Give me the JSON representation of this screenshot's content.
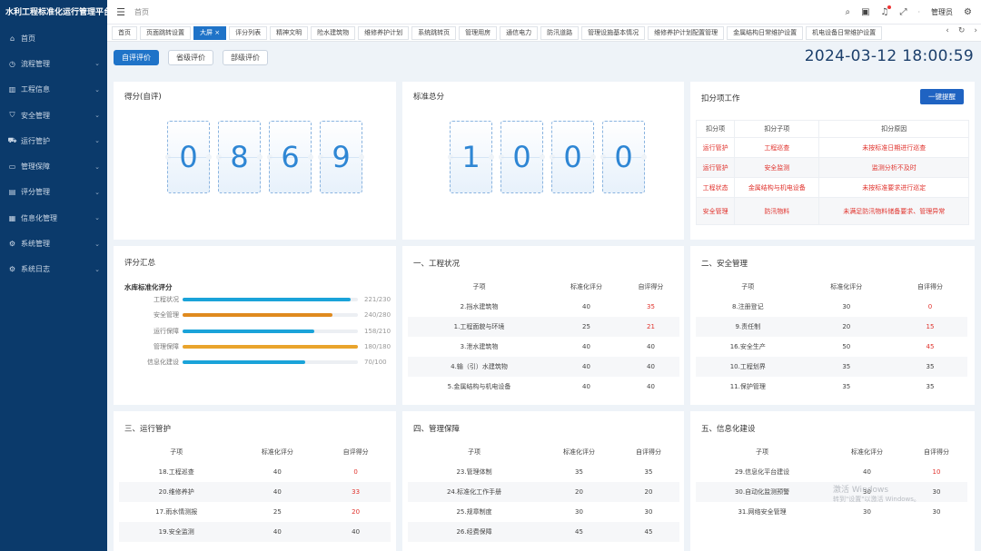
{
  "app": {
    "title": "水利工程标准化运行管理平台"
  },
  "sidebar": {
    "items": [
      {
        "label": "首页",
        "icon": "home-icon",
        "glyph": "⌂",
        "arrow": ""
      },
      {
        "label": "流程管理",
        "icon": "flow-icon",
        "glyph": "◷",
        "arrow": "⌄"
      },
      {
        "label": "工程信息",
        "icon": "building-icon",
        "glyph": "▥",
        "arrow": "⌄"
      },
      {
        "label": "安全管理",
        "icon": "shield-icon",
        "glyph": "⛉",
        "arrow": "⌄"
      },
      {
        "label": "运行管护",
        "icon": "truck-icon",
        "glyph": "⛟",
        "arrow": "⌄"
      },
      {
        "label": "管理保障",
        "icon": "monitor-icon",
        "glyph": "▭",
        "arrow": "⌄"
      },
      {
        "label": "评分管理",
        "icon": "document-icon",
        "glyph": "▤",
        "arrow": "⌄"
      },
      {
        "label": "信息化管理",
        "icon": "chart-icon",
        "glyph": "▦",
        "arrow": "⌄"
      },
      {
        "label": "系统管理",
        "icon": "gear-icon",
        "glyph": "⚙",
        "arrow": "⌄"
      },
      {
        "label": "系统日志",
        "icon": "log-icon",
        "glyph": "⚙",
        "arrow": "⌄"
      }
    ]
  },
  "topbar": {
    "breadcrumb": "首页",
    "user": "管理员"
  },
  "tabs": [
    "首页",
    "页面跳转设置",
    "大屏 ×",
    "评分列表",
    "精神文明",
    "险水建筑物",
    "维修养护计划",
    "系统跳转页",
    "管理用房",
    "通信电力",
    "防汛道路",
    "管理设施基本情况",
    "维修养护计划配置管理",
    "金属结构日常维护设置",
    "机电设备日常维护设置"
  ],
  "active_tab": 2,
  "eval_buttons": [
    "自评评价",
    "省级评价",
    "部级评价"
  ],
  "datetime": "2024-03-12 18:00:59",
  "self_score": {
    "title": "得分(自评)",
    "digits": [
      "0",
      "8",
      "6",
      "9"
    ]
  },
  "standard_total": {
    "title": "标准总分",
    "digits": [
      "1",
      "0",
      "0",
      "0"
    ]
  },
  "deduction": {
    "title": "扣分项工作",
    "button": "一键提醒",
    "headers": [
      "扣分项",
      "扣分子项",
      "扣分原因"
    ],
    "rows": [
      [
        "运行管护",
        "工程巡查",
        "未按标准日期进行巡查"
      ],
      [
        "运行管护",
        "安全监测",
        "监测分析不及时"
      ],
      [
        "工程状态",
        "金属结构与机电设备",
        "未按标准要求进行巡定"
      ],
      [
        "安全管理",
        "防汛物料",
        "未满足防汛物料储备要求、管理异常"
      ]
    ]
  },
  "summary": {
    "title": "评分汇总",
    "subtitle": "水库标准化评分",
    "items": [
      {
        "label": "工程状况",
        "score": 221,
        "total": 230,
        "text": "221/230",
        "color": "#1aa3d9"
      },
      {
        "label": "安全管理",
        "score": 240,
        "total": 280,
        "text": "240/280",
        "color": "#e08a1e"
      },
      {
        "label": "运行保障",
        "score": 158,
        "total": 210,
        "text": "158/210",
        "color": "#1aa3d9"
      },
      {
        "label": "管理保障",
        "score": 180,
        "total": 180,
        "text": "180/180",
        "color": "#e9a42c"
      },
      {
        "label": "信息化建设",
        "score": 70,
        "total": 100,
        "text": "70/100",
        "color": "#1aa3d9"
      }
    ]
  },
  "score_headers": [
    "子项",
    "标准化评分",
    "自评得分"
  ],
  "sections": [
    {
      "title": "一、工程状况",
      "rows": [
        [
          "2.挡水建筑物",
          "40",
          "35"
        ],
        [
          "1.工程面貌与环境",
          "25",
          "21"
        ],
        [
          "3.泄水建筑物",
          "40",
          "40"
        ],
        [
          "4.输（引）水建筑物",
          "40",
          "40"
        ],
        [
          "5.金属结构与机电设备",
          "40",
          "40"
        ]
      ]
    },
    {
      "title": "二、安全管理",
      "rows": [
        [
          "8.注册登记",
          "30",
          "0"
        ],
        [
          "9.责任制",
          "20",
          "15"
        ],
        [
          "16.安全生产",
          "50",
          "45"
        ],
        [
          "10.工程划界",
          "35",
          "35"
        ],
        [
          "11.保护管理",
          "35",
          "35"
        ]
      ]
    },
    {
      "title": "三、运行管护",
      "rows": [
        [
          "18.工程巡查",
          "40",
          "0"
        ],
        [
          "20.维修养护",
          "40",
          "33"
        ],
        [
          "17.雨水情测报",
          "25",
          "20"
        ],
        [
          "19.安全监测",
          "40",
          "40"
        ]
      ]
    },
    {
      "title": "四、管理保障",
      "rows": [
        [
          "23.管理体制",
          "35",
          "35"
        ],
        [
          "24.标准化工作手册",
          "20",
          "20"
        ],
        [
          "25.规章制度",
          "30",
          "30"
        ],
        [
          "26.经费保障",
          "45",
          "45"
        ]
      ]
    },
    {
      "title": "五、信息化建设",
      "rows": [
        [
          "29.信息化平台建设",
          "40",
          "10"
        ],
        [
          "30.自动化监测预警",
          "30",
          "30"
        ],
        [
          "31.网络安全管理",
          "30",
          "30"
        ]
      ]
    }
  ],
  "watermark": {
    "line1": "激活 Windows",
    "line2": "转到\"设置\"以激活 Windows。"
  }
}
